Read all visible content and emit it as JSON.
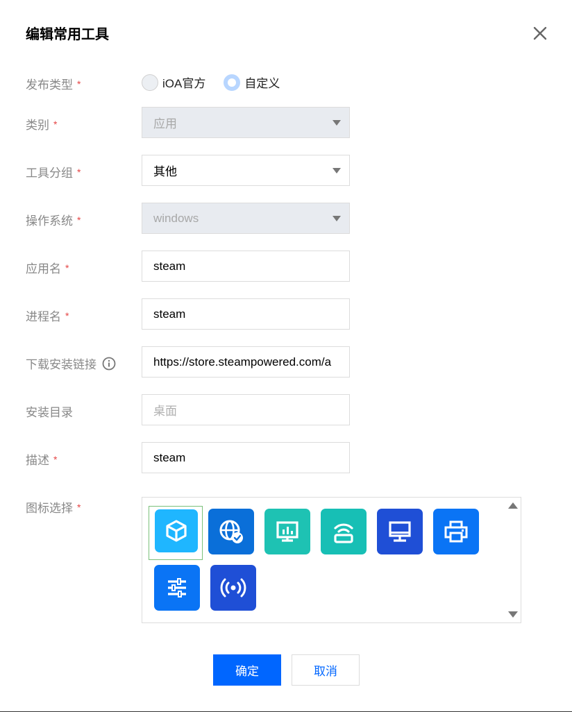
{
  "dialog": {
    "title": "编辑常用工具",
    "required_mark": "*"
  },
  "form": {
    "release_type": {
      "label": "发布类型",
      "options": [
        "iOA官方",
        "自定义"
      ],
      "selected": "自定义"
    },
    "category": {
      "label": "类别",
      "value": "应用"
    },
    "tool_group": {
      "label": "工具分组",
      "value": "其他"
    },
    "os": {
      "label": "操作系统",
      "value": "windows"
    },
    "app_name": {
      "label": "应用名",
      "value": "steam"
    },
    "process_name": {
      "label": "进程名",
      "value": "steam"
    },
    "download_link": {
      "label": "下载安装链接",
      "value": "https://store.steampowered.com/a"
    },
    "install_dir": {
      "label": "安装目录",
      "placeholder": "桌面"
    },
    "description": {
      "label": "描述",
      "value": "steam"
    },
    "icon_select": {
      "label": "图标选择",
      "icons": [
        {
          "name": "cube-icon",
          "color": "#1fb6ff"
        },
        {
          "name": "globe-check-icon",
          "color": "#0a6fd9"
        },
        {
          "name": "monitor-chart-icon",
          "color": "#1ec2b3"
        },
        {
          "name": "router-wifi-icon",
          "color": "#17bfb5"
        },
        {
          "name": "desktop-icon",
          "color": "#1f4fd6"
        },
        {
          "name": "printer-icon",
          "color": "#0a74f5"
        },
        {
          "name": "sliders-icon",
          "color": "#0a74f5"
        },
        {
          "name": "broadcast-icon",
          "color": "#1f4fd6"
        }
      ],
      "selected_index": 0
    }
  },
  "buttons": {
    "confirm": "确定",
    "cancel": "取消"
  },
  "colors": {
    "primary": "#0066ff",
    "required": "#e54545",
    "label": "#888888"
  }
}
